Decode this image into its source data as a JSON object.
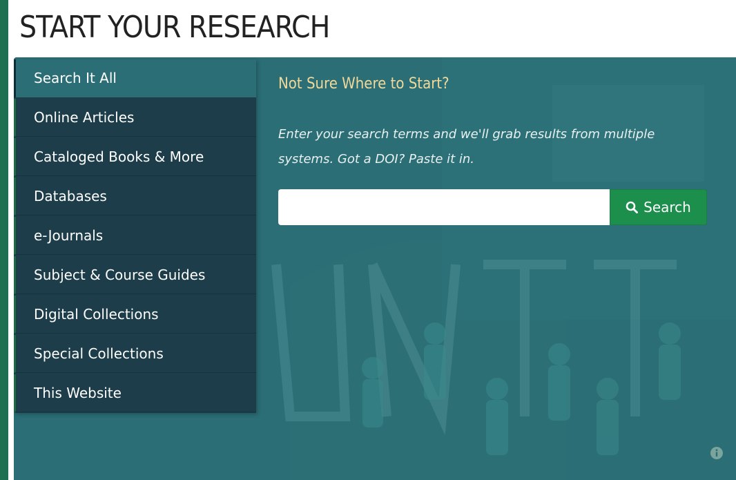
{
  "page": {
    "title": "START YOUR RESEARCH"
  },
  "sidebar": {
    "items": [
      {
        "label": "Search It All",
        "active": true
      },
      {
        "label": "Online Articles"
      },
      {
        "label": "Cataloged Books & More"
      },
      {
        "label": "Databases"
      },
      {
        "label": "e-Journals"
      },
      {
        "label": "Subject & Course Guides"
      },
      {
        "label": "Digital Collections"
      },
      {
        "label": "Special Collections"
      },
      {
        "label": "This Website"
      }
    ]
  },
  "content": {
    "title": "Not Sure Where to Start?",
    "description": "Enter your search terms and we'll grab results from multiple systems. Got a DOI? Paste it in."
  },
  "search": {
    "value": "",
    "placeholder": "",
    "button_label": "Search",
    "button_icon": "search-icon"
  },
  "info": {
    "icon": "info-icon"
  },
  "colors": {
    "page_border": "#1f6f53",
    "panel_teal": "#2b6e75",
    "sidebar_dark": "#1c3d49",
    "accent_gold": "#f0d99a",
    "button_green": "#1d8f4d"
  }
}
